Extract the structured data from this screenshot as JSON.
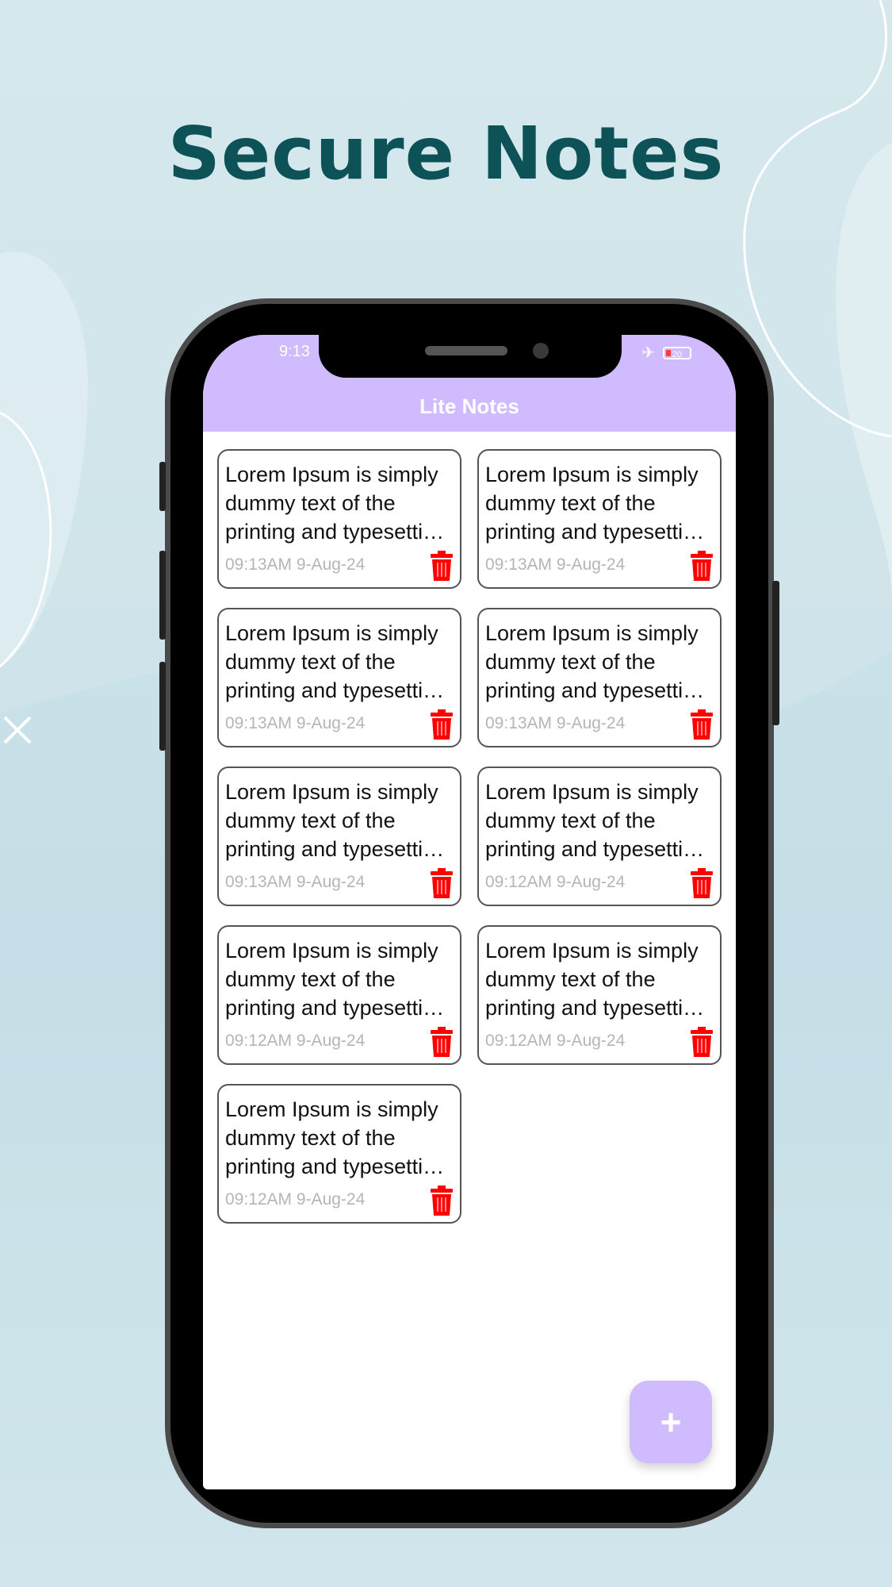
{
  "headline": "Secure Notes",
  "status": {
    "time": "9:13",
    "battery": "20"
  },
  "app": {
    "title": "Lite Notes",
    "fab_label": "+"
  },
  "notes": [
    {
      "text": "Lorem Ipsum is simply dummy text of the printing and typesetting industry.",
      "time": "09:13AM 9-Aug-24"
    },
    {
      "text": "Lorem Ipsum is simply dummy text of the printing and typesetting industry.",
      "time": "09:13AM 9-Aug-24"
    },
    {
      "text": "Lorem Ipsum is simply dummy text of the printing and typesetting industry.",
      "time": "09:13AM 9-Aug-24"
    },
    {
      "text": "Lorem Ipsum is simply dummy text of the printing and typesetting industry.",
      "time": "09:13AM 9-Aug-24"
    },
    {
      "text": "Lorem Ipsum is simply dummy text of the printing and typesetting industry.",
      "time": "09:13AM 9-Aug-24"
    },
    {
      "text": "Lorem Ipsum is simply dummy text of the printing and typesetting industry.",
      "time": "09:12AM 9-Aug-24"
    },
    {
      "text": "Lorem Ipsum is simply dummy text of the printing and typesetting industry.",
      "time": "09:12AM 9-Aug-24"
    },
    {
      "text": "Lorem Ipsum is simply dummy text of the printing and typesetting industry.",
      "time": "09:12AM 9-Aug-24"
    },
    {
      "text": "Lorem Ipsum is simply dummy text of the printing and typesetting industry.",
      "time": "09:12AM 9-Aug-24"
    }
  ],
  "colors": {
    "accent": "#d1bbff",
    "headline": "#0d5257",
    "trash": "#ff0000",
    "background": "#d6e8ec"
  },
  "icons": {
    "delete": "trash-icon",
    "add": "plus-icon",
    "airplane": "airplane-icon",
    "battery": "battery-icon"
  }
}
